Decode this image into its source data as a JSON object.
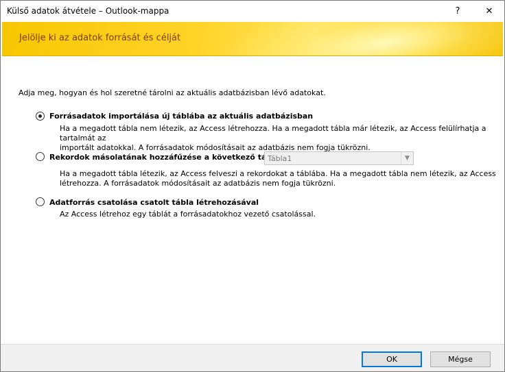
{
  "window": {
    "title": "Külső adatok átvétele – Outlook-mappa",
    "help_label": "?",
    "close_label": "✕"
  },
  "banner": {
    "title": "Jelölje ki az adatok forrását és célját"
  },
  "intro": "Adja meg, hogyan és hol szeretné tárolni az aktuális adatbázisban lévő adatokat.",
  "options": [
    {
      "label": "Forrásadatok importálása új táblába az aktuális adatbázisban",
      "checked": true,
      "description_line1": "Ha a megadott tábla nem létezik, az Access létrehozza. Ha a megadott tábla már létezik, az Access felülírhatja a tartalmát az",
      "description_line2": "importált adatokkal. A forrásadatok módosításait az adatbázis nem fogja tükrözni."
    },
    {
      "label": "Rekordok másolatának hozzáfűzése a következő táblához:",
      "checked": false,
      "combo_value": "Tábla1",
      "description_line1": "Ha a megadott tábla létezik, az Access felveszi a rekordokat a táblába. Ha a megadott tábla nem létezik, az Access",
      "description_line2": "létrehozza. A forrásadatok módosításait az adatbázis nem fogja tükrözni."
    },
    {
      "label": "Adatforrás csatolása csatolt tábla létrehozásával",
      "checked": false,
      "description_line1": "Az Access létrehoz egy táblát a forrásadatokhoz vezető csatolással."
    }
  ],
  "footer": {
    "ok_label": "OK",
    "cancel_label": "Mégse"
  },
  "colors": {
    "banner_text": "#7a3d00",
    "banner_bg": "#ffd42a",
    "footer_bg": "#f0f0f0",
    "default_button_border": "#0078d7"
  }
}
